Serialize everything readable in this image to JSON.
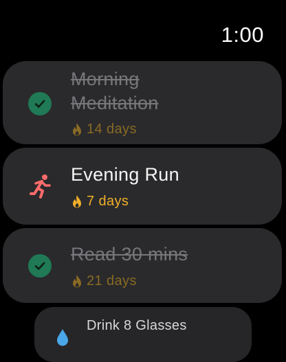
{
  "status": {
    "time": "1:00"
  },
  "habits": [
    {
      "title": "Morning Meditation",
      "streak": "14 days",
      "completed": true,
      "icon": "checkmark-icon"
    },
    {
      "title": "Evening Run",
      "streak": "7 days",
      "completed": false,
      "icon": "running-person-icon"
    },
    {
      "title": "Read 30 mins",
      "streak": "21 days",
      "completed": true,
      "icon": "checkmark-icon"
    },
    {
      "title": "Drink 8 Glasses",
      "completed": false,
      "icon": "water-drop-icon"
    }
  ],
  "colors": {
    "background": "#000000",
    "card": "#2a2a2c",
    "check_green": "#1f7a55",
    "flame_active": "#f0b02a",
    "flame_muted": "#8a6a24",
    "runner": "#ff6b6b",
    "water": "#4aa8e8",
    "completed_text": "#77777b"
  }
}
